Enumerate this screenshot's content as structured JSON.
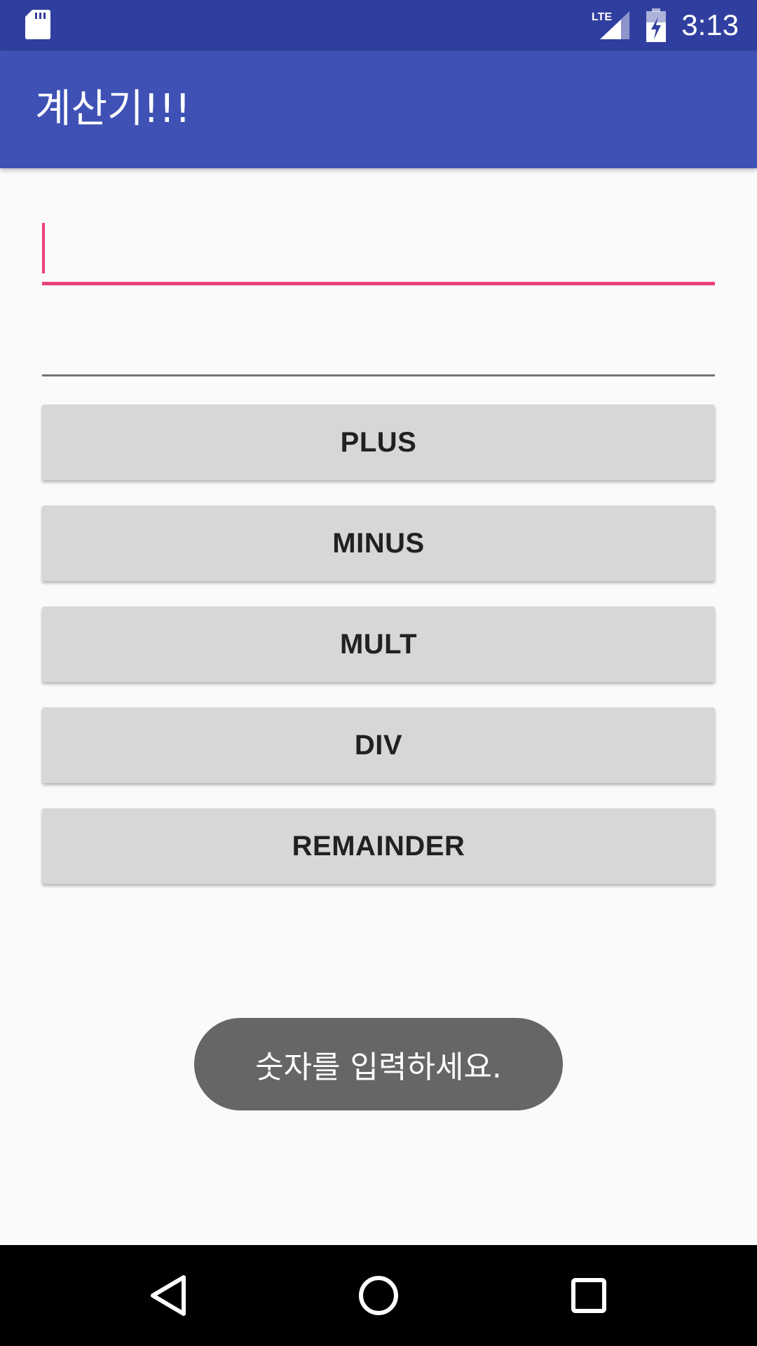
{
  "status_bar": {
    "time": "3:13",
    "network_label": "LTE",
    "icons": [
      "sd-card-icon",
      "lte-signal-icon",
      "battery-charging-icon"
    ]
  },
  "app_bar": {
    "title": "계산기!!!",
    "color": "#3f51b5"
  },
  "form": {
    "first_number": {
      "value": "",
      "placeholder": ""
    },
    "second_number": {
      "value": "",
      "placeholder": ""
    },
    "accent_color": "#ec407a"
  },
  "buttons": {
    "plus": "PLUS",
    "minus": "MINUS",
    "mult": "MULT",
    "div": "DIV",
    "remainder": "REMAINDER"
  },
  "toast": {
    "message": "숫자를 입력하세요."
  },
  "nav_bar": {
    "icons": [
      "back-icon",
      "home-icon",
      "recents-icon"
    ]
  }
}
